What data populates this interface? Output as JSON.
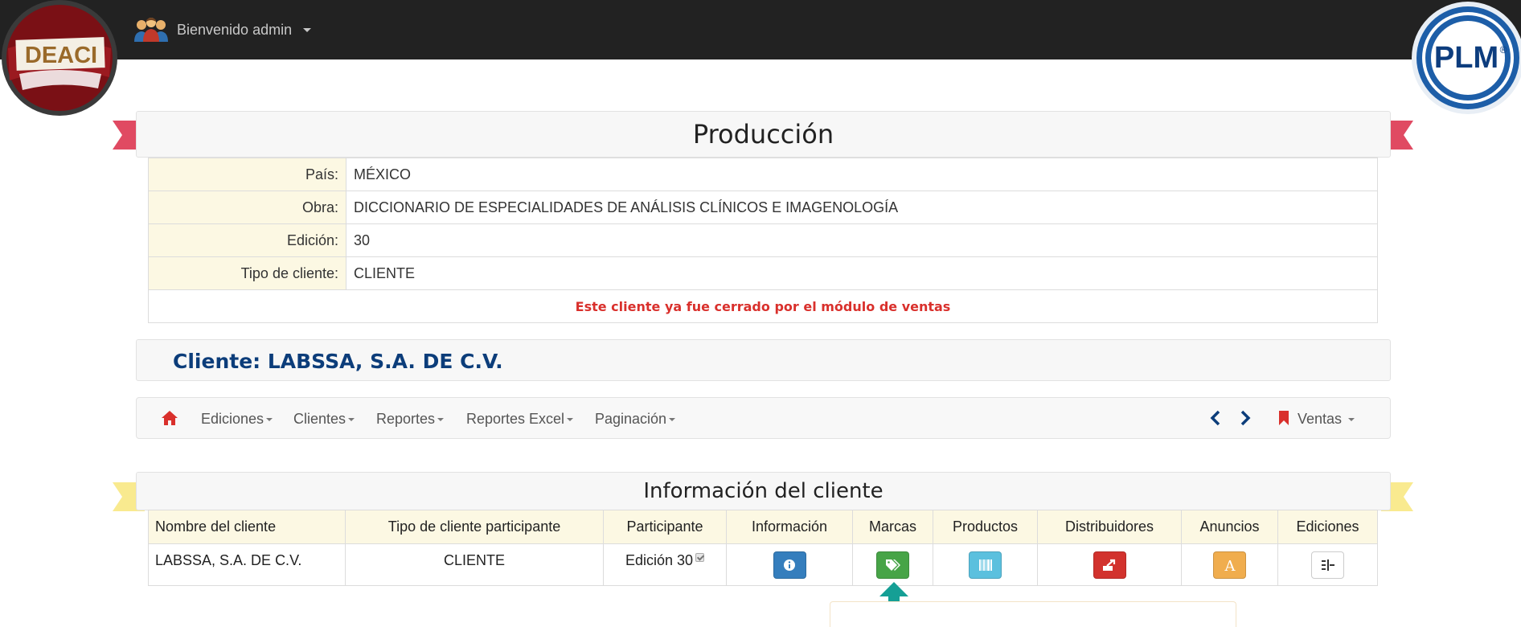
{
  "topbar": {
    "welcome_text": "Bienvenido admin",
    "icon": "users-icon"
  },
  "logos": {
    "left": "DEACI",
    "right": "PLM",
    "right_mark": "®"
  },
  "production": {
    "title": "Producción",
    "rows": [
      {
        "label": "País:",
        "value": "MÉXICO"
      },
      {
        "label": "Obra:",
        "value": "DICCIONARIO DE ESPECIALIDADES DE ANÁLISIS CLÍNICOS E IMAGENOLOGÍA"
      },
      {
        "label": "Edición:",
        "value": "30"
      },
      {
        "label": "Tipo de cliente:",
        "value": "CLIENTE"
      }
    ],
    "notice": "Este cliente ya fue cerrado por el módulo de ventas"
  },
  "client": {
    "title": "Cliente: LABSSA, S.A. DE C.V."
  },
  "navbar": {
    "home_icon": "home-icon",
    "items": [
      "Ediciones",
      "Clientes",
      "Reportes",
      "Reportes Excel",
      "Paginación"
    ],
    "ventas_label": "Ventas"
  },
  "client_info": {
    "title": "Información del cliente",
    "headers": [
      "Nombre del cliente",
      "Tipo de cliente participante",
      "Participante",
      "Información",
      "Marcas",
      "Productos",
      "Distribuidores",
      "Anuncios",
      "Ediciones"
    ],
    "row": {
      "name": "LABSSA, S.A. DE C.V.",
      "type": "CLIENTE",
      "participant": "Edición 30",
      "participant_checked": true
    },
    "buttons": [
      {
        "name": "info-icon",
        "color": "#357ebd"
      },
      {
        "name": "tags-icon",
        "color": "#47a447"
      },
      {
        "name": "barcode-icon",
        "color": "#5bc0de"
      },
      {
        "name": "share-icon",
        "color": "#d2322d"
      },
      {
        "name": "font-icon",
        "color": "#f0ad4e",
        "glyph": "A"
      },
      {
        "name": "tree-icon",
        "color": "#ffffff"
      }
    ]
  },
  "colors": {
    "ribbon_red": "#e04a62",
    "ribbon_yellow": "#f9ea8f",
    "label_bg": "#fcf8e3",
    "notice_red": "#d9302c",
    "client_blue": "#0c3d7a",
    "teal_arrow": "#159f95"
  }
}
